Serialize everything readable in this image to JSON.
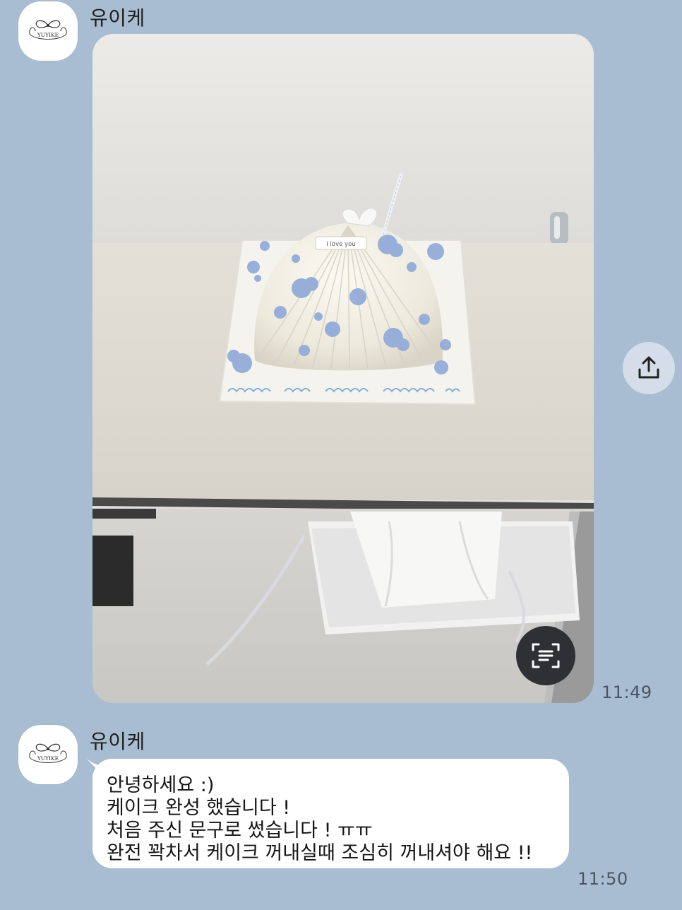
{
  "messages": [
    {
      "sender": "유이케",
      "avatar_text": "YUYIKE",
      "type": "photo",
      "photo_icon": "cake-photo",
      "cake_topper_text": "I love you",
      "time": "11:49",
      "share_icon": "share-icon",
      "scan_icon": "text-scan-icon"
    },
    {
      "sender": "유이케",
      "avatar_text": "YUYIKE",
      "type": "text",
      "lines": [
        "안녕하세요 :)",
        "케이크 완성 했습니다 !",
        "처음 주신 문구로 썼습니다 ! ㅠㅠ",
        "완전 꽉차서 케이크 꺼내실때 조심히 꺼내셔야 해요 !!"
      ],
      "time": "11:50"
    }
  ],
  "colors": {
    "chat_background": "#a9bdd2",
    "bubble": "#ffffff",
    "share_button": "#d5dee8",
    "scan_button": "#2f3034"
  }
}
